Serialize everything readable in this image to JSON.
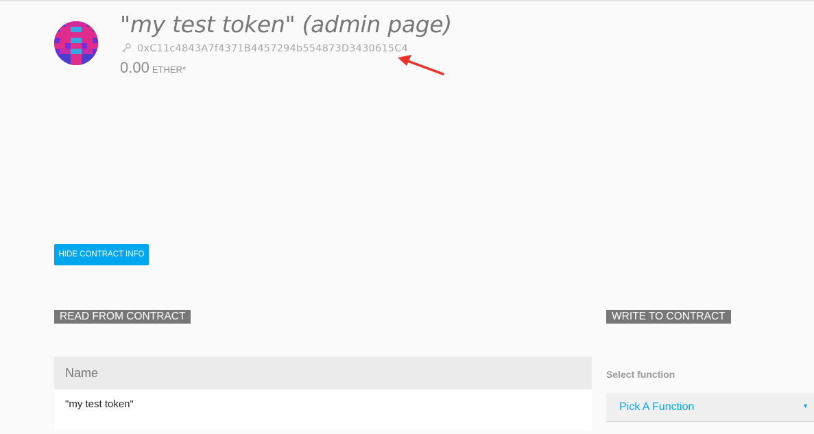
{
  "contract": {
    "title": "\"my test token\" (admin page)",
    "address": "0xC11c4843A7f4371B4457294b554873D3430615C4",
    "balance": "0.00",
    "balance_unit": "ETHER*"
  },
  "buttons": {
    "hide_contract_info": "HIDE CONTRACT INFO"
  },
  "read_section": {
    "heading": "READ FROM CONTRACT",
    "fields": [
      {
        "label": "Name",
        "value": "\"my test token\""
      }
    ]
  },
  "write_section": {
    "heading": "WRITE TO CONTRACT",
    "select_label": "Select function",
    "select_value": "Pick A Function"
  },
  "icons": {
    "key": "key-icon",
    "caret": "caret-down-icon",
    "annotation": "red-arrow-annotation"
  },
  "colors": {
    "accent": "#00a7ee",
    "heading_bg": "#777777",
    "annotation": "#e8342b"
  }
}
